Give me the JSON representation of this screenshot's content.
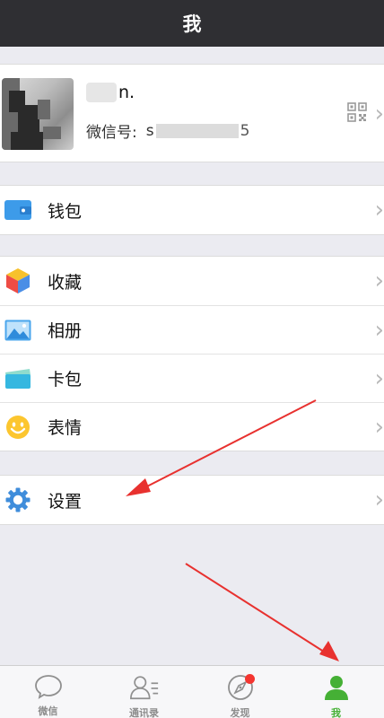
{
  "header": {
    "title": "我"
  },
  "profile": {
    "name": "n.",
    "wechat_label": "微信号:",
    "wechat_value": "s",
    "wechat_tail": "5"
  },
  "wallet": {
    "label": "钱包",
    "icon": "wallet-icon"
  },
  "menu": [
    {
      "label": "收藏",
      "icon": "favorites-cube-icon"
    },
    {
      "label": "相册",
      "icon": "album-icon"
    },
    {
      "label": "卡包",
      "icon": "card-package-icon"
    },
    {
      "label": "表情",
      "icon": "smiley-icon"
    }
  ],
  "settings": {
    "label": "设置",
    "icon": "gear-icon"
  },
  "tabbar": {
    "items": [
      {
        "label": "微信",
        "icon": "chat-bubble-icon",
        "active": false
      },
      {
        "label": "通讯录",
        "icon": "contacts-icon",
        "active": false
      },
      {
        "label": "发现",
        "icon": "compass-icon",
        "active": false,
        "badge": true
      },
      {
        "label": "我",
        "icon": "person-icon",
        "active": true
      }
    ]
  },
  "colors": {
    "header_bg": "#2f2f33",
    "accent_green": "#45b035",
    "badge_red": "#f43530",
    "annotation_arrow": "#e8312f",
    "wallet_blue": "#3d9be9"
  }
}
